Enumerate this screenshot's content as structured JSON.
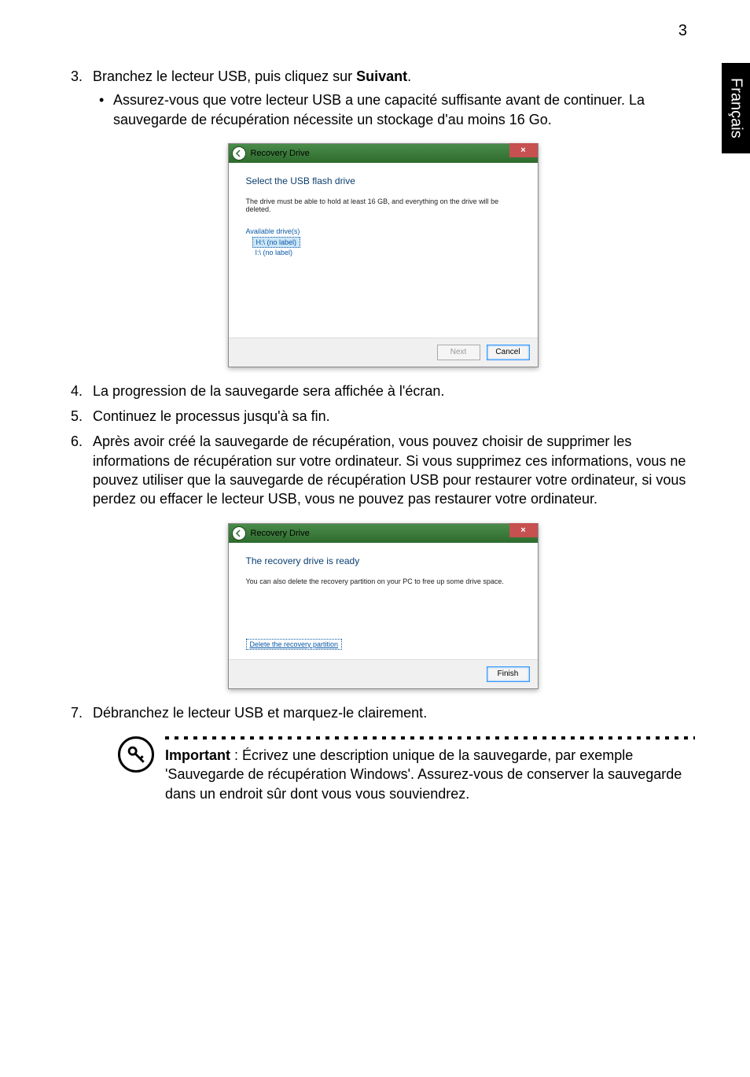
{
  "page": {
    "number": "3",
    "language_tab": "Français"
  },
  "steps": {
    "s3": {
      "num": "3.",
      "text_before": "Branchez le lecteur USB, puis cliquez sur ",
      "bold": "Suivant",
      "text_after": ".",
      "bullet": "Assurez-vous que votre lecteur USB a une capacité suffisante avant de continuer. La sauvegarde de récupération nécessite un stockage d'au moins 16 Go."
    },
    "s4": {
      "num": "4.",
      "text": "La progression de la sauvegarde sera affichée à l'écran."
    },
    "s5": {
      "num": "5.",
      "text": "Continuez le processus jusqu'à sa fin."
    },
    "s6": {
      "num": "6.",
      "text": "Après avoir créé la sauvegarde de récupération, vous pouvez choisir de supprimer les informations de récupération sur votre ordinateur. Si vous supprimez ces informations, vous ne pouvez utiliser que la sauvegarde de récupération USB pour restaurer votre ordinateur, si vous perdez ou effacer le lecteur USB, vous ne pouvez pas restaurer votre ordinateur."
    },
    "s7": {
      "num": "7.",
      "text": "Débranchez le lecteur USB et marquez-le clairement."
    }
  },
  "dialog1": {
    "title": "Recovery Drive",
    "heading": "Select the USB flash drive",
    "desc": "The drive must be able to hold at least 16 GB, and everything on the drive will be deleted.",
    "avail": "Available drive(s)",
    "drive_h": "H:\\ (no label)",
    "drive_i": "I:\\ (no label)",
    "btn_next": "Next",
    "btn_cancel": "Cancel",
    "close": "×"
  },
  "dialog2": {
    "title": "Recovery Drive",
    "heading": "The recovery drive is ready",
    "desc": "You can also delete the recovery partition on your PC to free up some drive space.",
    "link": "Delete the recovery partition",
    "btn_finish": "Finish",
    "close": "×"
  },
  "note": {
    "bold": "Important",
    "text": " : Écrivez une description unique de la sauvegarde, par exemple 'Sauvegarde de récupération Windows'. Assurez-vous de conserver la sauvegarde dans un endroit sûr dont vous vous souviendrez."
  }
}
